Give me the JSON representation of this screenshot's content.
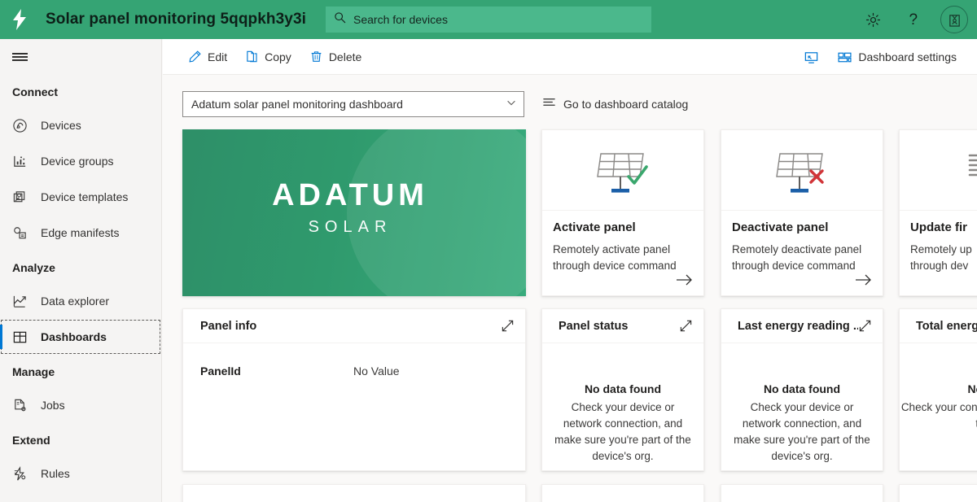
{
  "header": {
    "logo_icon": "lightning-bolt-icon",
    "title": "Solar panel monitoring 5qqpkh3y3i",
    "search": {
      "icon": "search-icon",
      "placeholder": "Search for devices",
      "value": ""
    },
    "icons": [
      {
        "name": "settings-icon",
        "label": "Settings"
      },
      {
        "name": "help-icon",
        "label": "Help"
      },
      {
        "name": "account-icon",
        "label": "Account"
      }
    ]
  },
  "sidebar": {
    "menu_icon": "hamburger-icon",
    "groups": [
      {
        "label": "Connect",
        "items": [
          {
            "label": "Devices",
            "icon": "devices-icon",
            "selected": false
          },
          {
            "label": "Device groups",
            "icon": "device-groups-icon",
            "selected": false
          },
          {
            "label": "Device templates",
            "icon": "device-templates-icon",
            "selected": false
          },
          {
            "label": "Edge manifests",
            "icon": "edge-manifests-icon",
            "selected": false
          }
        ]
      },
      {
        "label": "Analyze",
        "items": [
          {
            "label": "Data explorer",
            "icon": "data-explorer-icon",
            "selected": false
          },
          {
            "label": "Dashboards",
            "icon": "dashboards-icon",
            "selected": true
          }
        ]
      },
      {
        "label": "Manage",
        "items": [
          {
            "label": "Jobs",
            "icon": "jobs-icon",
            "selected": false
          }
        ]
      },
      {
        "label": "Extend",
        "items": [
          {
            "label": "Rules",
            "icon": "rules-icon",
            "selected": false
          }
        ]
      }
    ]
  },
  "commandbar": {
    "buttons": [
      {
        "label": "Edit",
        "icon": "pencil-icon"
      },
      {
        "label": "Copy",
        "icon": "copy-icon"
      },
      {
        "label": "Delete",
        "icon": "trash-icon"
      }
    ],
    "right": [
      {
        "label": "",
        "icon": "present-screen-icon"
      },
      {
        "label": "Dashboard settings",
        "icon": "dashboard-layout-icon"
      }
    ]
  },
  "main": {
    "dashboard_select": {
      "value": "Adatum solar panel monitoring dashboard",
      "chevron_icon": "chevron-down-icon"
    },
    "catalog_link": {
      "label": "Go to dashboard catalog",
      "icon": "list-icon"
    },
    "banner": {
      "brand_primary": "ADATUM",
      "brand_secondary": "SOLAR",
      "sun_icon": "sun-icon",
      "color_start": "#2e8f68",
      "color_end": "#38ab7c",
      "sun_color": "#4fe0a8"
    },
    "action_cards": [
      {
        "title": "Activate panel",
        "desc_line1": "Remotely activate panel",
        "desc_line2": "through device command",
        "icon": "solar-panel-check-icon",
        "badge_color": "#3aa76d",
        "arrow_icon": "arrow-right-icon"
      },
      {
        "title": "Deactivate panel",
        "desc_line1": "Remotely deactivate panel",
        "desc_line2": "through device command",
        "icon": "solar-panel-x-icon",
        "badge_color": "#d13438",
        "arrow_icon": "arrow-right-icon"
      },
      {
        "title": "Update fir",
        "desc_line1": "Remotely up",
        "desc_line2": "through dev",
        "icon": "firmware-update-icon",
        "badge_color": "#605e5c",
        "arrow_icon": "arrow-right-icon"
      }
    ],
    "tiles": [
      {
        "title": "Panel info",
        "expand_icon": "expand-icon",
        "kind": "properties",
        "rows": [
          {
            "key": "PanelId",
            "value": "No Value"
          }
        ]
      },
      {
        "title": "Panel status",
        "expand_icon": "expand-icon",
        "kind": "nodata",
        "nodata_title": "No data found",
        "nodata_text": "Check your device or network connection, and make sure you're part of the device's org."
      },
      {
        "title": "Last energy reading ...",
        "expand_icon": "expand-icon",
        "kind": "nodata",
        "nodata_title": "No data found",
        "nodata_text": "Check your device or network connection, and make sure you're part of the device's org."
      },
      {
        "title": "Total energ",
        "expand_icon": "expand-icon",
        "kind": "nodata",
        "nodata_title": "No d",
        "nodata_text": "Check your connection, a part of th"
      }
    ]
  }
}
